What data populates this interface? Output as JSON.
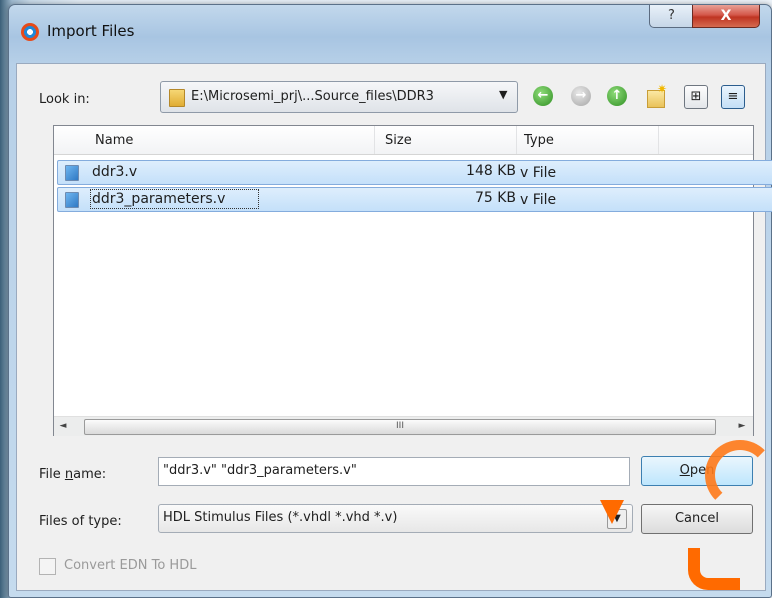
{
  "window": {
    "title": "Import Files",
    "help_glyph": "?",
    "close_glyph": "X"
  },
  "look_in": {
    "label": "Look in:",
    "path": "E:\\Microsemi_prj\\...Source_files\\DDR3",
    "arrow": "▼"
  },
  "toolbar": {
    "back_icon": "back-arrow-icon",
    "forward_icon": "forward-arrow-icon",
    "up_icon": "up-folder-icon",
    "new_folder_icon": "new-folder-icon",
    "list_view_icon": "list-view-icon",
    "detail_view_icon": "detail-view-icon"
  },
  "file_list": {
    "columns": [
      "Name",
      "Size",
      "Type"
    ],
    "rows": [
      {
        "name": "ddr3.v",
        "size": "148 KB",
        "type": "v File"
      },
      {
        "name": "ddr3_parameters.v",
        "size": "75 KB",
        "type": "v File"
      }
    ],
    "scroll_left": "◄",
    "scroll_thumb": "III",
    "scroll_right": "►"
  },
  "file_name": {
    "label_pre": "File ",
    "label_u": "n",
    "label_post": "ame:",
    "value": "\"ddr3.v\" \"ddr3_parameters.v\""
  },
  "file_type": {
    "label": "Files of type:",
    "value": "HDL Stimulus Files (*.vhdl *.vhd *.v)",
    "arrow": "▼"
  },
  "buttons": {
    "open_u": "O",
    "open_rest": "pen",
    "cancel": "Cancel"
  },
  "convert": {
    "label": "Convert EDN To HDL",
    "checked": false,
    "enabled": false
  },
  "colors": {
    "selection": "#c4e0fa",
    "watermark": "#ff6a00",
    "title_bar": "#b7d0e8",
    "close": "#c9402e"
  }
}
